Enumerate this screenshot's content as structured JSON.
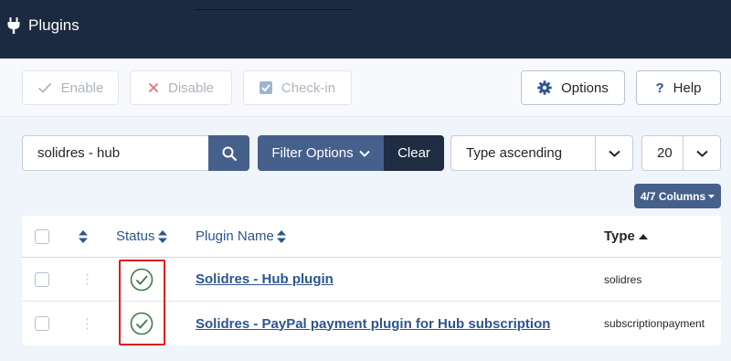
{
  "header": {
    "title": "Plugins",
    "icon": "plug-icon"
  },
  "toolbar": {
    "enable_label": "Enable",
    "disable_label": "Disable",
    "checkin_label": "Check-in",
    "options_label": "Options",
    "help_label": "Help"
  },
  "filters": {
    "search_value": "solidres - hub",
    "filter_options_label": "Filter Options",
    "clear_label": "Clear",
    "sort_value": "Type ascending",
    "limit_value": "20",
    "columns_label": "4/7 Columns"
  },
  "table": {
    "headers": {
      "status": "Status",
      "plugin_name": "Plugin Name",
      "type": "Type"
    },
    "rows": [
      {
        "name": "Solidres - Hub plugin",
        "type": "solidres",
        "status": "enabled"
      },
      {
        "name": "Solidres - PayPal payment plugin for Hub subscription",
        "type": "subscriptionpayment",
        "status": "enabled"
      }
    ]
  },
  "colors": {
    "header_bg": "#1c2a41",
    "accent": "#45608b",
    "link": "#2d5591",
    "success": "#3f7a4a",
    "highlight": "#e01b1b"
  }
}
